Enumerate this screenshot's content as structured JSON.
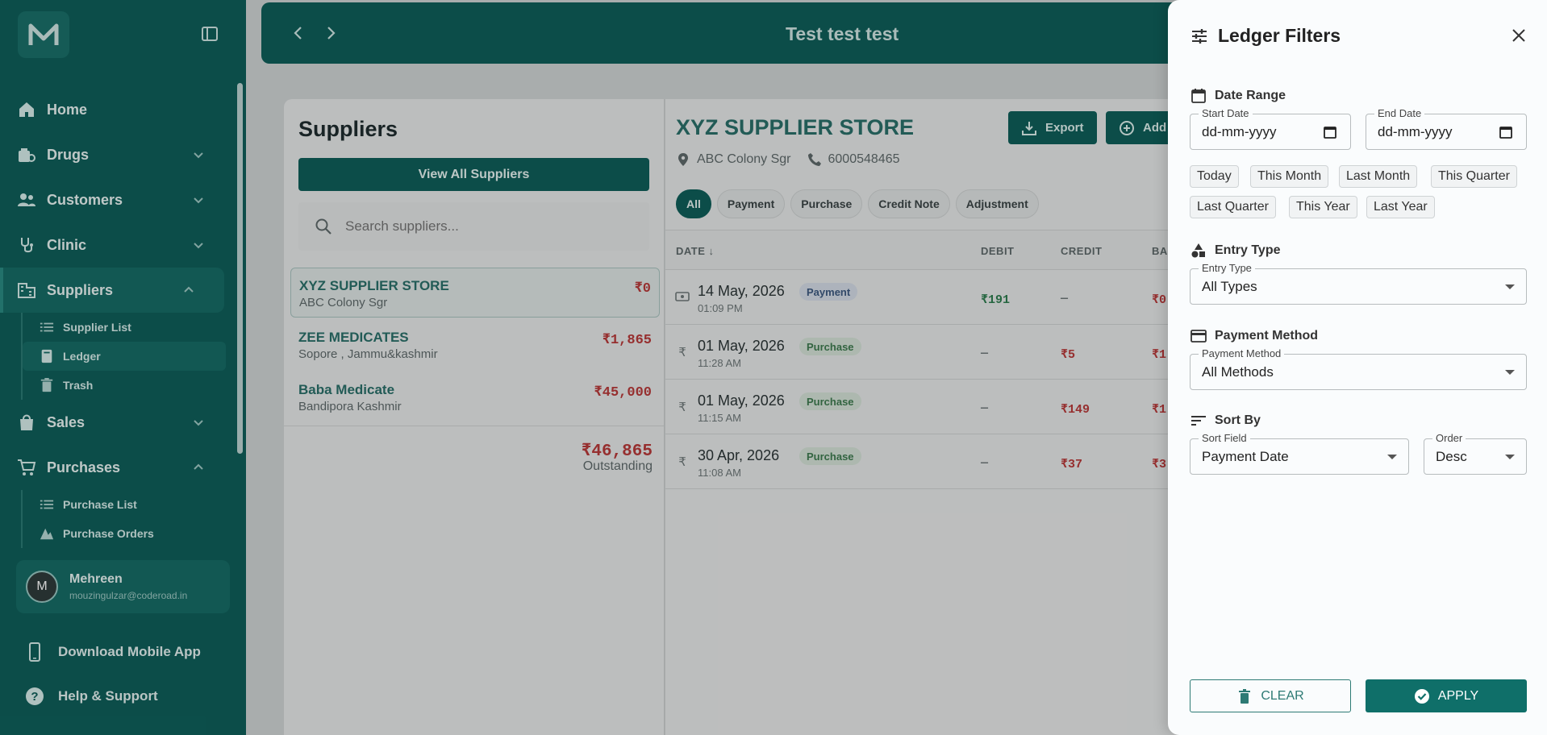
{
  "sidebar": {
    "logo_letter": "M",
    "items": [
      {
        "label": "Home",
        "icon": "home-icon",
        "has_chevron": false
      },
      {
        "label": "Drugs",
        "icon": "drugs-icon",
        "has_chevron": true
      },
      {
        "label": "Customers",
        "icon": "customers-icon",
        "has_chevron": true
      },
      {
        "label": "Clinic",
        "icon": "clinic-icon",
        "has_chevron": true
      },
      {
        "label": "Suppliers",
        "icon": "suppliers-icon",
        "has_chevron": true,
        "expanded": true,
        "active": true
      },
      {
        "label": "Sales",
        "icon": "sales-icon",
        "has_chevron": true
      },
      {
        "label": "Purchases",
        "icon": "purchases-icon",
        "has_chevron": true,
        "expanded": true
      }
    ],
    "suppliers_sub": [
      {
        "label": "Supplier List",
        "icon": "list-icon"
      },
      {
        "label": "Ledger",
        "icon": "book-icon",
        "active": true
      },
      {
        "label": "Trash",
        "icon": "trash-icon"
      }
    ],
    "purchases_sub": [
      {
        "label": "Purchase List",
        "icon": "list-icon"
      },
      {
        "label": "Purchase Orders",
        "icon": "orders-icon"
      }
    ],
    "user": {
      "initial": "M",
      "name": "Mehreen",
      "email": "mouzingulzar@coderoad.in"
    },
    "download_app": "Download Mobile App",
    "help": "Help & Support"
  },
  "topbar": {
    "title": "Test test test"
  },
  "suppliers": {
    "title": "Suppliers",
    "view_all": "View All Suppliers",
    "search_placeholder": "Search suppliers...",
    "rows": [
      {
        "name": "XYZ SUPPLIER STORE",
        "address": "ABC Colony Sgr",
        "amount": "₹0"
      },
      {
        "name": "ZEE MEDICATES",
        "address": "Sopore , Jammu&kashmir",
        "amount": "₹1,865"
      },
      {
        "name": "Baba Medicate",
        "address": "Bandipora Kashmir",
        "amount": "₹45,000"
      }
    ],
    "total": "₹46,865",
    "total_label": "Outstanding"
  },
  "ledger": {
    "title": "XYZ SUPPLIER STORE",
    "address": "ABC Colony Sgr",
    "phone": "6000548465",
    "export_label": "Export",
    "add_label": "Add",
    "chips": [
      "All",
      "Payment",
      "Purchase",
      "Credit Note",
      "Adjustment"
    ],
    "columns": {
      "date": "DATE ↓",
      "debit": "DEBIT",
      "credit": "CREDIT",
      "balance": "BA"
    },
    "rows": [
      {
        "date": "14 May, 2026",
        "time": "01:09 PM",
        "type": "Payment",
        "debit": "₹191",
        "credit": "—",
        "balance": "₹0"
      },
      {
        "date": "01 May, 2026",
        "time": "11:28 AM",
        "type": "Purchase",
        "debit": "—",
        "credit": "₹5",
        "balance": "₹1"
      },
      {
        "date": "01 May, 2026",
        "time": "11:15 AM",
        "type": "Purchase",
        "debit": "—",
        "credit": "₹149",
        "balance": "₹1"
      },
      {
        "date": "30 Apr, 2026",
        "time": "11:08 AM",
        "type": "Purchase",
        "debit": "—",
        "credit": "₹37",
        "balance": "₹3"
      }
    ]
  },
  "filters": {
    "title": "Ledger Filters",
    "date_range": {
      "label": "Date Range",
      "start_label": "Start Date",
      "start_value": "dd-mm-yyyy",
      "end_label": "End Date",
      "end_value": "dd-mm-yyyy",
      "presets": [
        "Today",
        "This Month",
        "Last Month",
        "This Quarter",
        "Last Quarter",
        "This Year",
        "Last Year"
      ]
    },
    "entry_type": {
      "label": "Entry Type",
      "field_label": "Entry Type",
      "value": "All Types"
    },
    "payment_method": {
      "label": "Payment Method",
      "field_label": "Payment Method",
      "value": "All Methods"
    },
    "sort_by": {
      "label": "Sort By",
      "field_label": "Sort Field",
      "field_value": "Payment Date",
      "order_label": "Order",
      "order_value": "Desc"
    },
    "clear_label": "CLEAR",
    "apply_label": "APPLY"
  },
  "colors": {
    "brand": "#0f5f5a",
    "accent": "#0f6f69",
    "negative": "#b83a3a",
    "positive": "#2e7d4f"
  }
}
